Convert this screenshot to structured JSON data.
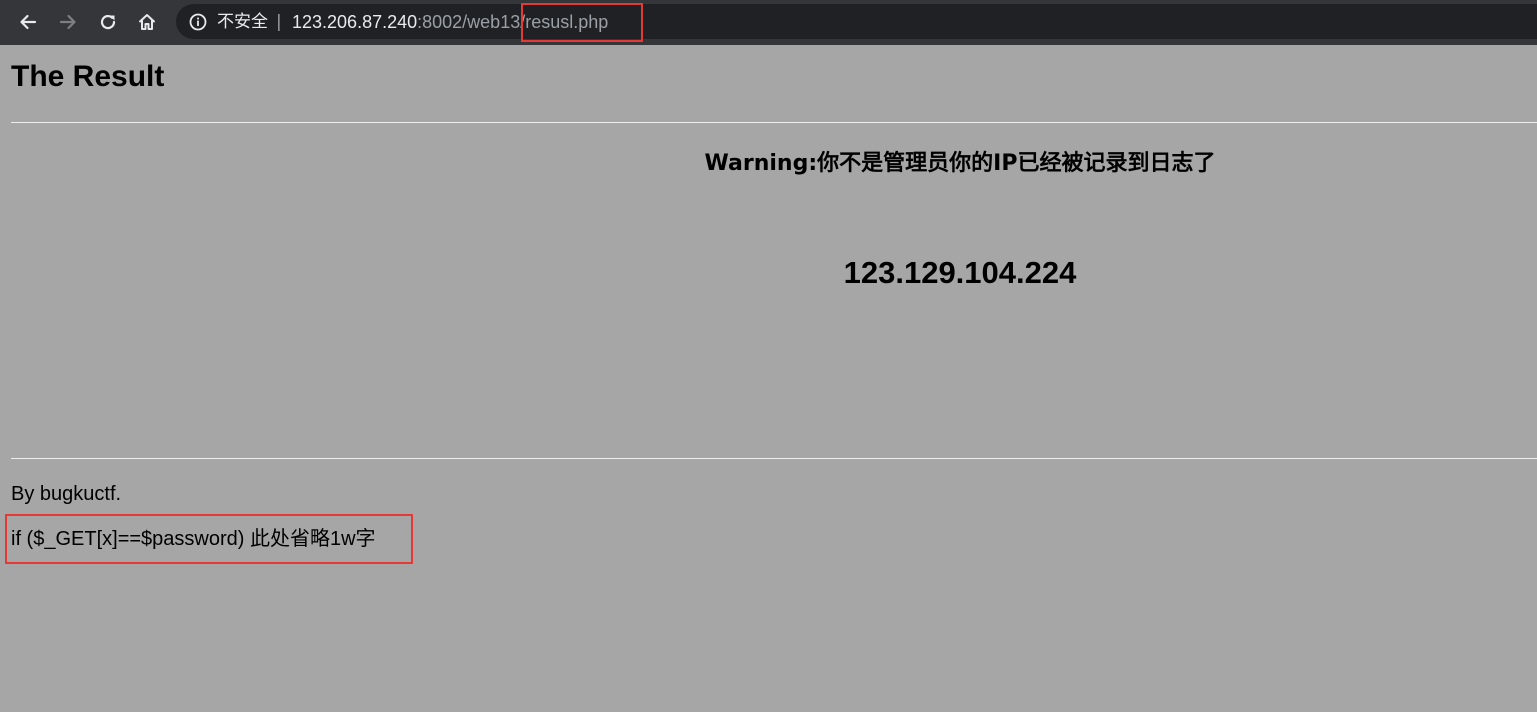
{
  "browser": {
    "nav": {
      "back_icon": "arrow-left-icon",
      "forward_icon": "arrow-right-icon",
      "reload_icon": "reload-icon",
      "home_icon": "home-icon"
    },
    "address_bar": {
      "info_icon": "info-icon",
      "security_label": "不安全",
      "separator": "|",
      "url_host": "123.206.87.240",
      "url_path_pre": ":8002/web13",
      "url_path_highlight": "/resusl.php"
    }
  },
  "page": {
    "title": "The Result",
    "warning": "Warning:你不是管理员你的IP已经被记录到日志了",
    "ip_address": "123.129.104.224",
    "byline": "By bugkuctf.",
    "code_hint": "if ($_GET[x]==$password) 此处省略1w字"
  },
  "colors": {
    "page_background": "#a6a6a6",
    "toolbar_background": "#35363a",
    "omnibox_background": "#202124",
    "annotation_red": "#e53935"
  }
}
